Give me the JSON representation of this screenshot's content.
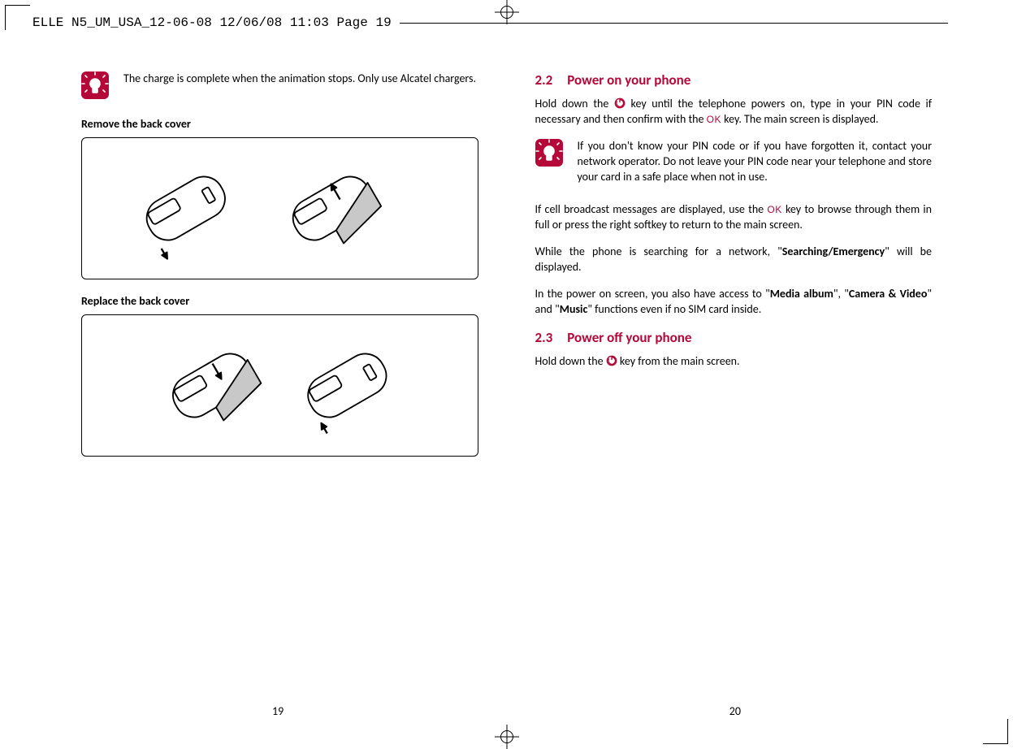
{
  "header": {
    "slug": "ELLE N5_UM_USA_12-06-08  12/06/08  11:03  Page 19"
  },
  "left": {
    "tip": "The charge is complete when the animation stops. Only use Alcatel chargers.",
    "remove_heading": "Remove the back cover",
    "replace_heading": "Replace the back cover",
    "page_num": "19"
  },
  "right": {
    "s22_num": "2.2",
    "s22_title": "Power on your phone",
    "p1a": "Hold down the ",
    "p1b": " key until the telephone powers on, type in your PIN code if necessary and then confirm with the ",
    "p1c": " key. The main screen is displayed.",
    "ok_label": "OK",
    "tip": "If you don't know your PIN code or if you have forgotten it, contact your network operator. Do not leave your PIN code near your telephone and store your card in a safe place when not in use.",
    "p2a": "If cell broadcast messages are displayed, use the ",
    "p2b": " key to browse through them in full or press the right softkey to return to the main screen.",
    "p3a": "While the phone is searching for a network, \"",
    "p3b": "Searching/Emergency",
    "p3c": "\" will be displayed.",
    "p4a": "In the power on screen, you also have access to \"",
    "p4b": "Media album",
    "p4c": "\", \"",
    "p4d": "Camera & Video",
    "p4e": "\" and \"",
    "p4f": "Music",
    "p4g": "\" functions even if no SIM card inside.",
    "s23_num": "2.3",
    "s23_title": "Power off your phone",
    "p5a": "Hold down the ",
    "p5b": " key from the main screen.",
    "page_num": "20"
  }
}
